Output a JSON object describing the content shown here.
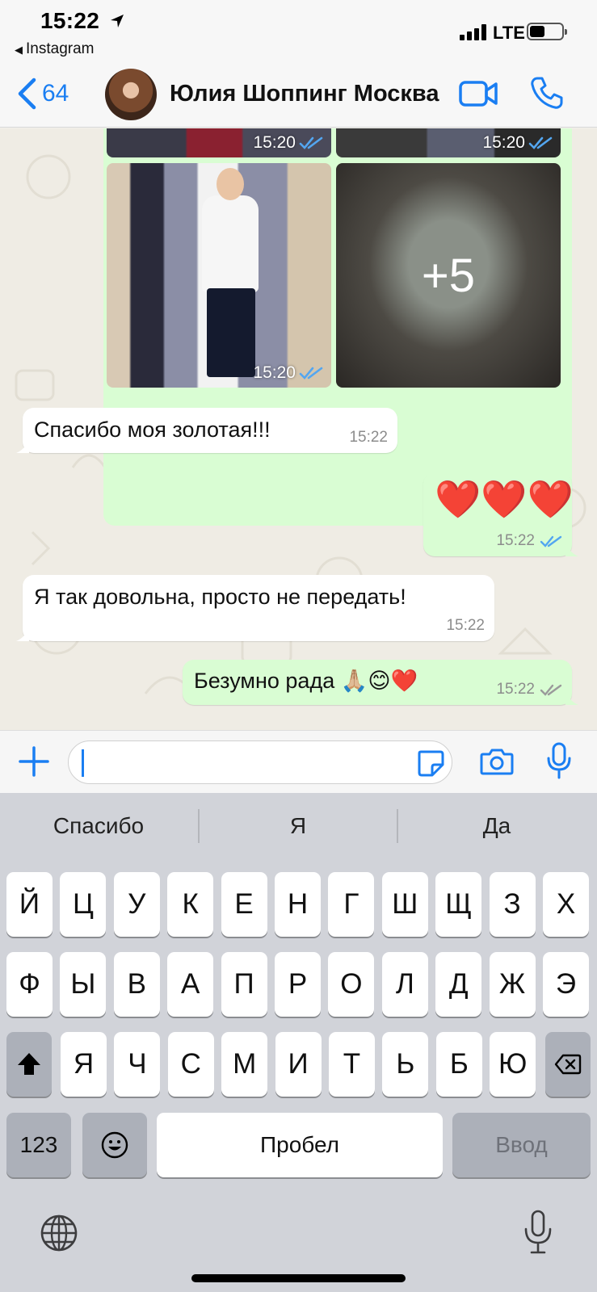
{
  "status_bar": {
    "time": "15:22",
    "back_app": "Instagram",
    "network": "LTE"
  },
  "nav": {
    "back_count": "64",
    "contact_name": "Юлия Шоппинг Москва"
  },
  "media": {
    "time_top_left": "15:20",
    "time_top_right": "15:20",
    "time_bottom_left": "15:20",
    "more_count": "+5"
  },
  "messages": [
    {
      "direction": "in",
      "text": "Спасибо моя золотая!!!",
      "time": "15:22"
    },
    {
      "direction": "out",
      "text": "❤️❤️❤️",
      "time": "15:22",
      "read": true
    },
    {
      "direction": "in",
      "text": "Я так довольна,  просто не передать!",
      "time": "15:22"
    },
    {
      "direction": "out",
      "text": "Безумно рада 🙏🏼😊❤️",
      "time": "15:22",
      "read": false
    }
  ],
  "input": {
    "value": ""
  },
  "keyboard": {
    "suggestions": [
      "Спасибо",
      "Я",
      "Да"
    ],
    "row1": [
      "Й",
      "Ц",
      "У",
      "К",
      "Е",
      "Н",
      "Г",
      "Ш",
      "Щ",
      "З",
      "Х"
    ],
    "row2": [
      "Ф",
      "Ы",
      "В",
      "А",
      "П",
      "Р",
      "О",
      "Л",
      "Д",
      "Ж",
      "Э"
    ],
    "row3": [
      "Я",
      "Ч",
      "С",
      "М",
      "И",
      "Т",
      "Ь",
      "Б",
      "Ю"
    ],
    "numbers_key": "123",
    "space_key": "Пробел",
    "return_key": "Ввод"
  },
  "colors": {
    "accent": "#1a7ef2",
    "outgoing_bubble": "#d9fdd3",
    "incoming_bubble": "#ffffff",
    "read_ticks": "#53a6f0"
  }
}
